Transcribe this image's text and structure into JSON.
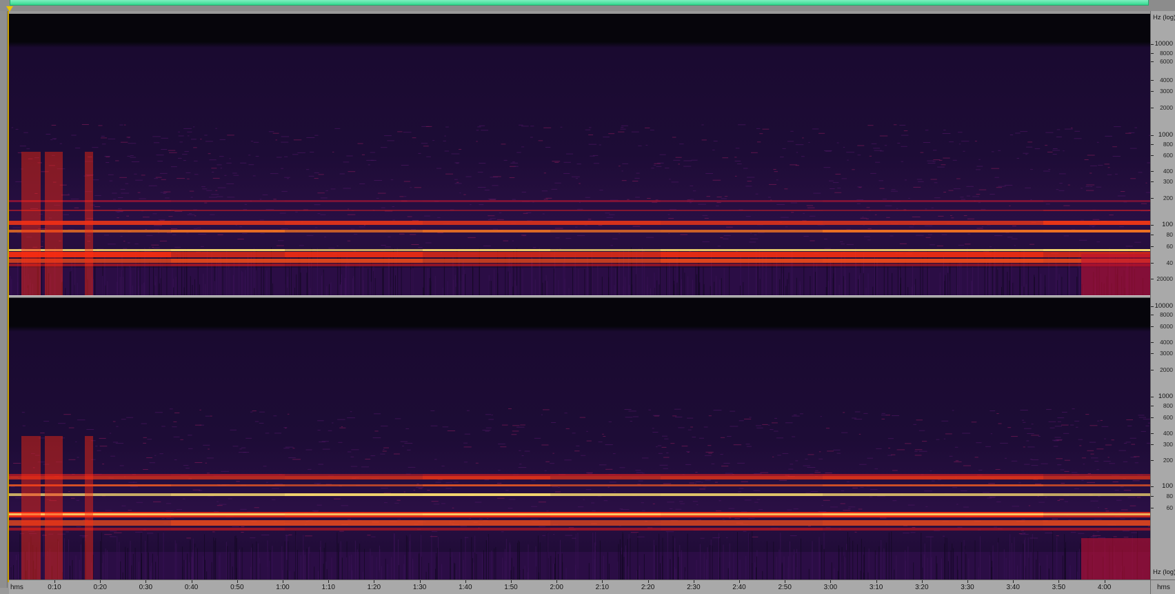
{
  "colors": {
    "background": "#1d0c36",
    "band_hot": "#ff2a10",
    "band_peak": "#ffe070",
    "overview_thumb": "#35d890",
    "playhead": "#c9a200"
  },
  "overview": {
    "label": ""
  },
  "time_ruler": {
    "unit_left": "hms",
    "unit_right": "hms",
    "ticks": [
      "0:10",
      "0:20",
      "0:30",
      "0:40",
      "0:50",
      "1:00",
      "1:10",
      "1:20",
      "1:30",
      "1:40",
      "1:50",
      "2:00",
      "2:10",
      "2:20",
      "2:30",
      "2:40",
      "2:50",
      "3:00",
      "3:10",
      "3:20",
      "3:30",
      "3:40",
      "3:50",
      "4:00"
    ]
  },
  "freq_ruler": {
    "unit": "Hz (log)",
    "ch1": [
      {
        "label": "10000",
        "major": true
      },
      {
        "label": "8000",
        "major": false
      },
      {
        "label": "6000",
        "major": false
      },
      {
        "label": "4000",
        "major": false
      },
      {
        "label": "3000",
        "major": false
      },
      {
        "label": "2000",
        "major": false
      },
      {
        "label": "1000",
        "major": true
      },
      {
        "label": "800",
        "major": false
      },
      {
        "label": "600",
        "major": false
      },
      {
        "label": "400",
        "major": false
      },
      {
        "label": "300",
        "major": false
      },
      {
        "label": "200",
        "major": false
      },
      {
        "label": "100",
        "major": true
      },
      {
        "label": "80",
        "major": false
      },
      {
        "label": "60",
        "major": false
      },
      {
        "label": "40",
        "major": false
      }
    ],
    "ch2": [
      {
        "label": "20000",
        "major": false
      },
      {
        "label": "10000",
        "major": true
      },
      {
        "label": "8000",
        "major": false
      },
      {
        "label": "6000",
        "major": false
      },
      {
        "label": "4000",
        "major": false
      },
      {
        "label": "3000",
        "major": false
      },
      {
        "label": "2000",
        "major": false
      },
      {
        "label": "1000",
        "major": true
      },
      {
        "label": "800",
        "major": false
      },
      {
        "label": "600",
        "major": false
      },
      {
        "label": "400",
        "major": false
      },
      {
        "label": "300",
        "major": false
      },
      {
        "label": "200",
        "major": false
      },
      {
        "label": "100",
        "major": true
      },
      {
        "label": "80",
        "major": false
      },
      {
        "label": "60",
        "major": false
      }
    ]
  }
}
